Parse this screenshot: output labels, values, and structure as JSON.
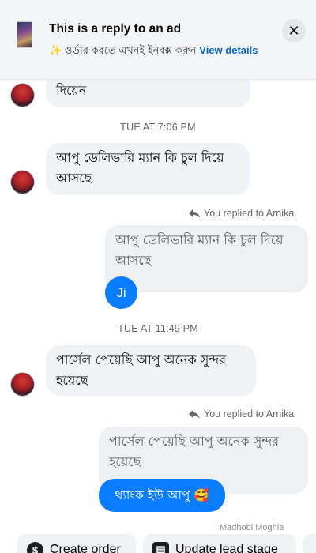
{
  "ad_banner": {
    "title": "This is a reply to an ad",
    "body_emoji": "✨",
    "body_text": "ওর্ডার করতে এখনই ইনবক্স করুন",
    "body_link": "View details",
    "close_icon": "close-icon"
  },
  "messages": {
    "m1_text": "দিয়েন",
    "time1": "TUE AT 7:06 PM",
    "m2_text": "আপু ডেলিভারি ম্যান কি চুল দিয়ে আসছে",
    "replied1": "You replied to Arnika",
    "m3_quoted": "আপু ডেলিভারি ম্যান কি চুল দিয়ে আসছে",
    "m3_reply": "Ji",
    "time2": "TUE AT 11:49 PM",
    "m4_text": "পার্সেল পেয়েছি আপু অনেক সুন্দর হয়েছে",
    "replied2": "You replied to Arnika",
    "m5_quoted": "পার্সেল পেয়েছি আপু অনেক সুন্দর হয়েছে",
    "m5_reply": "থ্যাংক ইউ আপু 🥰",
    "seen_by": "Madhobi Moghla"
  },
  "actions": {
    "create_order": "Create order",
    "update_lead": "Update lead stage"
  }
}
